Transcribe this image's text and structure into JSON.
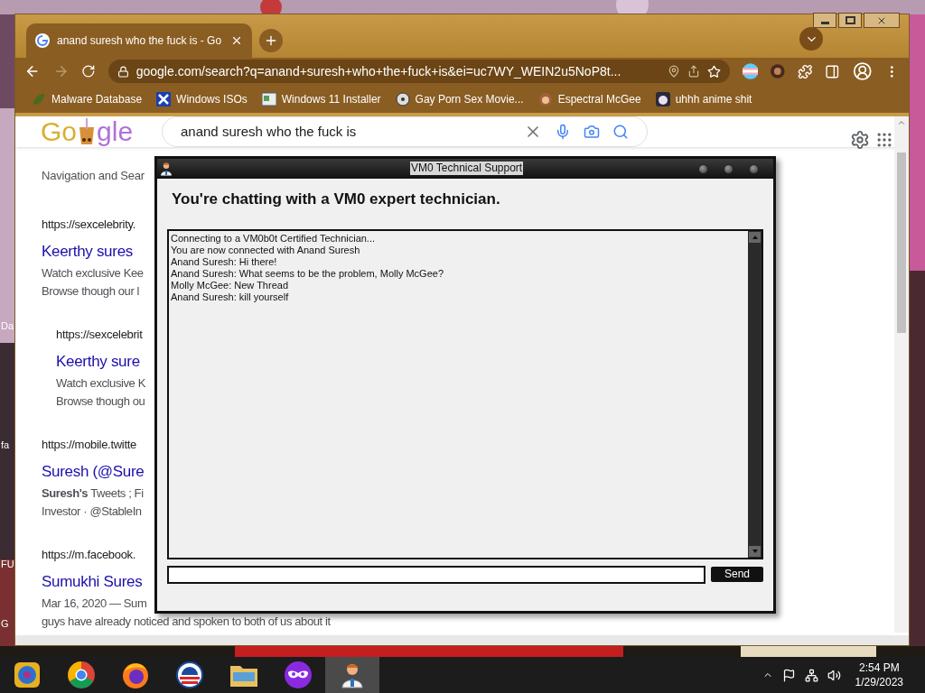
{
  "desktop_labels": [
    "Da",
    "fa",
    "FU",
    "G"
  ],
  "browser": {
    "tabs": [
      {
        "title": "anand suresh who the fuck is - Go",
        "selected": true
      }
    ],
    "address": "google.com/search?q=anand+suresh+who+the+fuck+is&ei=uc7WY_WEIN2u5NoP8t...",
    "bookmarks": [
      {
        "label": "Malware Database",
        "kind": "leaf"
      },
      {
        "label": "Windows ISOs",
        "kind": "x"
      },
      {
        "label": "Windows 11 Installer",
        "kind": "installer"
      },
      {
        "label": "Gay Porn Sex Movie...",
        "kind": "disk"
      },
      {
        "label": "Espectral McGee",
        "kind": "face"
      },
      {
        "label": "uhhh anime shit",
        "kind": "anime"
      }
    ],
    "logo": {
      "left": "Go",
      "right": "gle"
    },
    "search_query": "anand suresh who the fuck is",
    "results": [
      {
        "kind": "snippet",
        "text": "Navigation and Sear"
      },
      {
        "kind": "result",
        "indented": false,
        "url": "https://sexcelebrity.",
        "title": "Keerthy sures",
        "lines": [
          "Watch exclusive Kee",
          "Browse though our l"
        ]
      },
      {
        "kind": "result",
        "indented": true,
        "url": "https://sexcelebrit",
        "title": "Keerthy sure",
        "lines": [
          "Watch exclusive K",
          "Browse though ou"
        ]
      },
      {
        "kind": "result",
        "indented": false,
        "url": "https://mobile.twitte",
        "title": "Suresh (@Sure",
        "lines": [
          "**Suresh's** Tweets ; Fi",
          "Investor · @StableIn"
        ]
      },
      {
        "kind": "result",
        "indented": false,
        "url": "https://m.facebook.",
        "title": "Sumukhi Sures",
        "lines": [
          "Mar 16, 2020 — Sum",
          "guys have already noticed and spoken to both of us about it"
        ]
      }
    ]
  },
  "chat_window": {
    "title": "VM0 Technical Support",
    "heading": "You're chatting with a VM0 expert technician.",
    "messages": [
      "Connecting to a VM0b0t Certified Technician...",
      "You are now connected with Anand Suresh",
      "Anand Suresh: Hi there!",
      "Anand Suresh: What seems to be the problem, Molly McGee?",
      "Molly McGee: New Thread",
      "Anand Suresh: kill yourself"
    ],
    "send_button": "Send"
  },
  "taskbar": {
    "apps": [
      {
        "kind": "media",
        "selected": false
      },
      {
        "kind": "chrome",
        "selected": false
      },
      {
        "kind": "firefox",
        "selected": false
      },
      {
        "kind": "obama",
        "selected": false
      },
      {
        "kind": "folder",
        "selected": false
      },
      {
        "kind": "mask",
        "selected": false
      },
      {
        "kind": "technician",
        "selected": true
      }
    ],
    "time": "2:54 PM",
    "date": "1/29/2023"
  }
}
